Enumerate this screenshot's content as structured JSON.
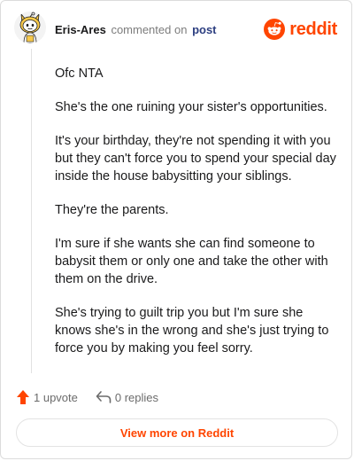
{
  "header": {
    "author": "Eris-Ares",
    "action_text": "commented on",
    "post_link": "post",
    "logo_text": "reddit",
    "avatar_icon": "snoo-avatar-icon",
    "logo_icon": "reddit-snoo-icon"
  },
  "comment": {
    "paragraphs": [
      "Ofc NTA",
      "She's the one ruining your sister's opportunities.",
      "It's your birthday, they're not spending it with you but they can't force you to spend your special day inside the house babysitting your siblings.",
      "They're the parents.",
      "I'm sure if she wants she can find someone to babysit them or only one and take the other with them on the drive.",
      "She's trying to guilt trip you but I'm sure she knows she's in the wrong and she's just trying to force you by making you feel sorry."
    ]
  },
  "actions": {
    "upvote_label": "1 upvote",
    "replies_label": "0 replies",
    "upvote_icon": "upvote-arrow-icon",
    "reply_icon": "reply-arrow-icon"
  },
  "footer": {
    "view_more_label": "View more on Reddit"
  },
  "colors": {
    "brand": "#ff4500",
    "link": "#2c3e80",
    "muted": "#7c7c7c"
  }
}
